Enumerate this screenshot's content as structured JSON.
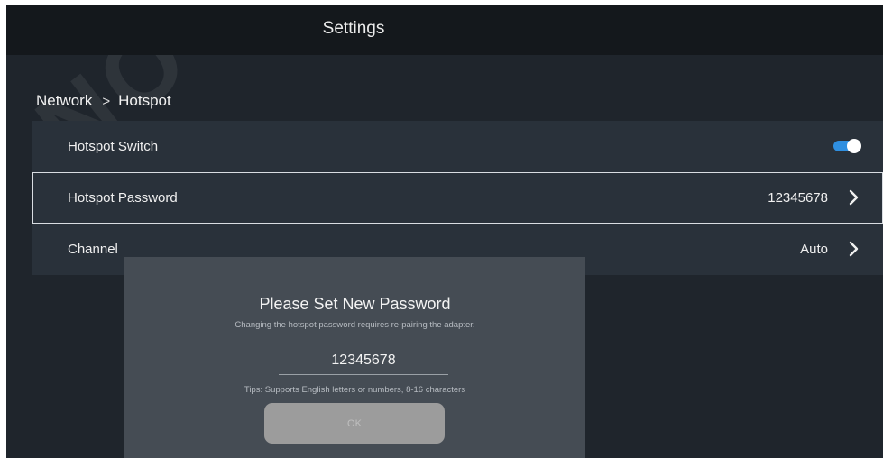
{
  "header": {
    "title": "Settings"
  },
  "breadcrumb": {
    "parent": "Network",
    "separator": ">",
    "current": "Hotspot"
  },
  "settings": {
    "rows": [
      {
        "label": "Hotspot Switch",
        "control": "toggle",
        "toggle_on": true
      },
      {
        "label": "Hotspot Password",
        "value": "12345678",
        "focused": true
      },
      {
        "label": "Channel",
        "value": "Auto"
      }
    ]
  },
  "dialog": {
    "title": "Please Set New Password",
    "subtitle": "Changing the hotspot password requires re-pairing the adapter.",
    "password_value": "12345678",
    "tips": "Tips: Supports English letters or numbers, 8-16 characters",
    "ok_label": "OK"
  },
  "watermark": {
    "text": "NOVASTAR"
  },
  "colors": {
    "background": "#1f252c",
    "title_bar": "#14181c",
    "row": "#29313a",
    "toggle_accent": "#2f8fe0",
    "dialog": "#454c54",
    "ok_button": "#9c9c9c"
  },
  "icons": {
    "row_chevron": "chevron-right-icon",
    "switch": "toggle-switch-icon"
  }
}
